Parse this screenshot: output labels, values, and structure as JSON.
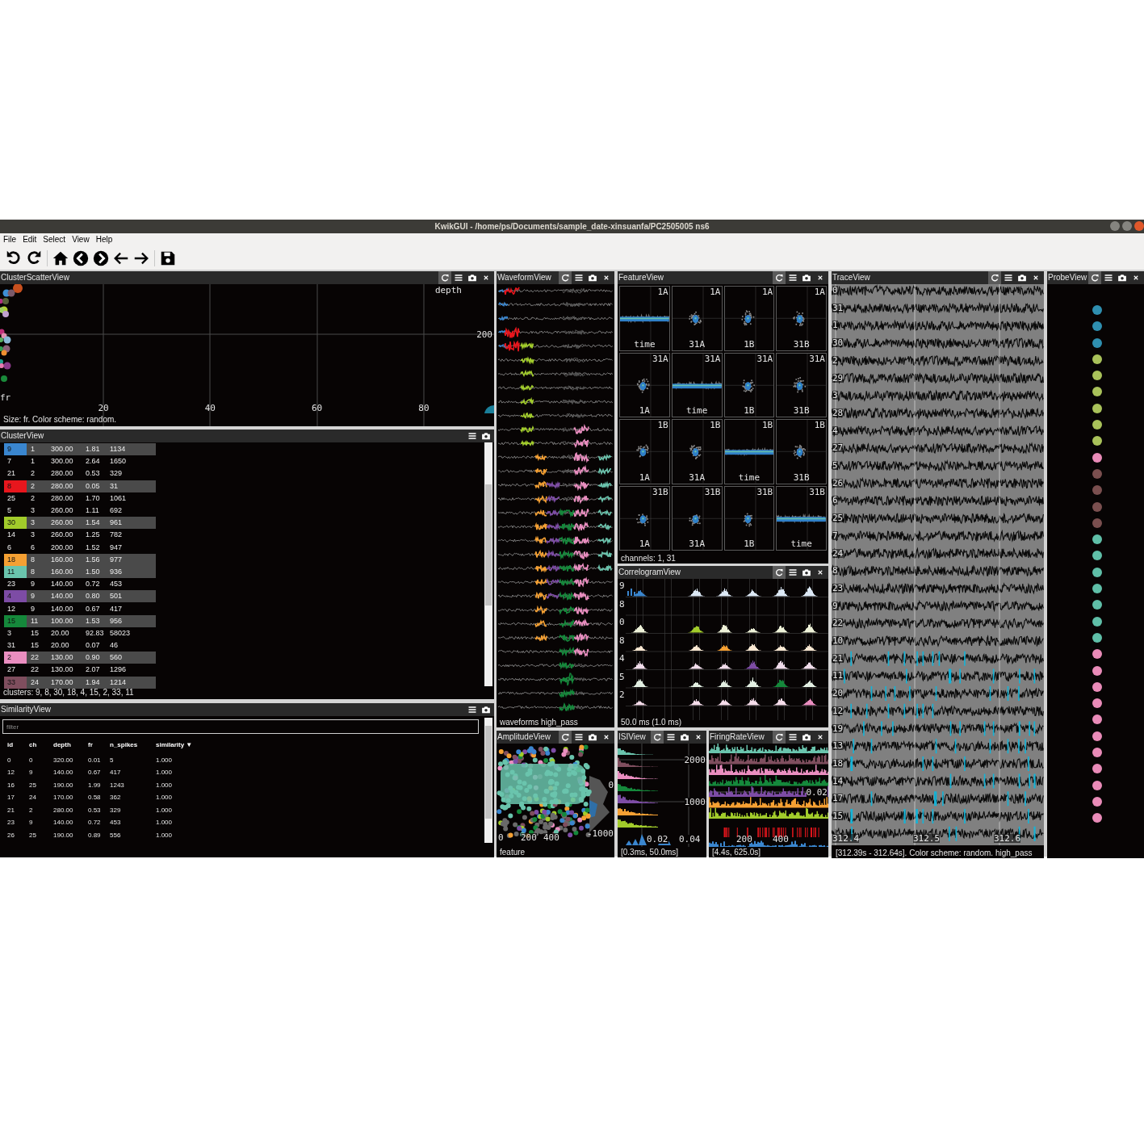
{
  "window": {
    "title": "KwikGUI - /home/ps/Documents/sample_date-xinsuanfa/PC2505005 ns6"
  },
  "menu": [
    "File",
    "Edit",
    "Select",
    "View",
    "Help"
  ],
  "cluster_scatter": {
    "title": "ClusterScatterView",
    "refresh_button": true,
    "close_button": true,
    "y_title": "depth",
    "y_ticks": [
      "200"
    ],
    "x_title": "fr",
    "x_ticks": [
      "20",
      "40",
      "60",
      "80"
    ],
    "status": "Size: fr. Color scheme: random."
  },
  "cluster_view": {
    "title": "ClusterView",
    "rows": [
      {
        "id": "9",
        "ch": "1",
        "depth": "300.00",
        "fr": "1.81",
        "n_spikes": "1134",
        "selected": true,
        "color": "#3a86cf"
      },
      {
        "id": "7",
        "ch": "1",
        "depth": "300.00",
        "fr": "2.64",
        "n_spikes": "1650",
        "selected": false
      },
      {
        "id": "21",
        "ch": "2",
        "depth": "280.00",
        "fr": "0.53",
        "n_spikes": "329",
        "selected": false
      },
      {
        "id": "8",
        "ch": "2",
        "depth": "280.00",
        "fr": "0.05",
        "n_spikes": "31",
        "selected": true,
        "color": "#e8161d"
      },
      {
        "id": "25",
        "ch": "2",
        "depth": "280.00",
        "fr": "1.70",
        "n_spikes": "1061",
        "selected": false
      },
      {
        "id": "5",
        "ch": "3",
        "depth": "260.00",
        "fr": "1.11",
        "n_spikes": "692",
        "selected": false
      },
      {
        "id": "30",
        "ch": "3",
        "depth": "260.00",
        "fr": "1.54",
        "n_spikes": "961",
        "selected": true,
        "color": "#a2cc2b"
      },
      {
        "id": "14",
        "ch": "3",
        "depth": "260.00",
        "fr": "1.25",
        "n_spikes": "782",
        "selected": false
      },
      {
        "id": "6",
        "ch": "6",
        "depth": "200.00",
        "fr": "1.52",
        "n_spikes": "947",
        "selected": false
      },
      {
        "id": "18",
        "ch": "8",
        "depth": "160.00",
        "fr": "1.56",
        "n_spikes": "977",
        "selected": true,
        "color": "#f5a033"
      },
      {
        "id": "11",
        "ch": "8",
        "depth": "160.00",
        "fr": "1.50",
        "n_spikes": "936",
        "selected": true,
        "color": "#6ac4ad"
      },
      {
        "id": "23",
        "ch": "9",
        "depth": "140.00",
        "fr": "0.72",
        "n_spikes": "453",
        "selected": false
      },
      {
        "id": "4",
        "ch": "9",
        "depth": "140.00",
        "fr": "0.80",
        "n_spikes": "501",
        "selected": true,
        "color": "#7d4ca5"
      },
      {
        "id": "12",
        "ch": "9",
        "depth": "140.00",
        "fr": "0.67",
        "n_spikes": "417",
        "selected": false
      },
      {
        "id": "15",
        "ch": "11",
        "depth": "100.00",
        "fr": "1.53",
        "n_spikes": "956",
        "selected": true,
        "color": "#15883b"
      },
      {
        "id": "3",
        "ch": "15",
        "depth": "20.00",
        "fr": "92.83",
        "n_spikes": "58023",
        "selected": false
      },
      {
        "id": "31",
        "ch": "15",
        "depth": "20.00",
        "fr": "0.07",
        "n_spikes": "46",
        "selected": false
      },
      {
        "id": "2",
        "ch": "22",
        "depth": "130.00",
        "fr": "0.90",
        "n_spikes": "560",
        "selected": true,
        "color": "#ea8ec0"
      },
      {
        "id": "27",
        "ch": "22",
        "depth": "130.00",
        "fr": "2.07",
        "n_spikes": "1296",
        "selected": false
      },
      {
        "id": "33",
        "ch": "24",
        "depth": "170.00",
        "fr": "1.94",
        "n_spikes": "1214",
        "selected": true,
        "color": "#7f4e5e"
      }
    ],
    "status": "clusters: 9, 8, 30, 18, 4, 15, 2, 33, 11"
  },
  "similarity_view": {
    "title": "SimilarityView",
    "filter": {
      "placeholder": "filter"
    },
    "columns": [
      "id",
      "ch",
      "depth",
      "fr",
      "n_spikes",
      "similarity ▼"
    ],
    "rows": [
      [
        "0",
        "0",
        "320.00",
        "0.01",
        "5",
        "1.000"
      ],
      [
        "12",
        "9",
        "140.00",
        "0.67",
        "417",
        "1.000"
      ],
      [
        "16",
        "25",
        "190.00",
        "1.99",
        "1243",
        "1.000"
      ],
      [
        "17",
        "24",
        "170.00",
        "0.58",
        "362",
        "1.000"
      ],
      [
        "21",
        "2",
        "280.00",
        "0.53",
        "329",
        "1.000"
      ],
      [
        "23",
        "9",
        "140.00",
        "0.72",
        "453",
        "1.000"
      ],
      [
        "26",
        "25",
        "190.00",
        "0.89",
        "556",
        "1.000"
      ]
    ]
  },
  "waveform_view": {
    "title": "WaveformView",
    "refresh_button": true,
    "close_button": true,
    "footer": "waveforms high_pass"
  },
  "amplitude_view": {
    "title": "AmplitudeView",
    "refresh_button": true,
    "close_button": true,
    "x_ticks": [
      "0",
      "200",
      "400"
    ],
    "y_ticks": [
      "0",
      "-1000"
    ],
    "footer": "feature"
  },
  "feature_view": {
    "title": "FeatureView",
    "refresh_button": true,
    "close_button": true,
    "grid": [
      [
        {
          "y_label": "1A",
          "x_label": "time",
          "kind": "time"
        },
        {
          "y_label": "1A",
          "x_label": "31A",
          "kind": "scatter"
        },
        {
          "y_label": "1A",
          "x_label": "1B",
          "kind": "scatter"
        },
        {
          "y_label": "1A",
          "x_label": "31B",
          "kind": "scatter"
        }
      ],
      [
        {
          "y_label": "31A",
          "x_label": "1A",
          "kind": "scatter"
        },
        {
          "y_label": "31A",
          "x_label": "time",
          "kind": "time"
        },
        {
          "y_label": "31A",
          "x_label": "1B",
          "kind": "scatter"
        },
        {
          "y_label": "31A",
          "x_label": "31B",
          "kind": "scatter"
        }
      ],
      [
        {
          "y_label": "1B",
          "x_label": "1A",
          "kind": "scatter"
        },
        {
          "y_label": "1B",
          "x_label": "31A",
          "kind": "scatter"
        },
        {
          "y_label": "1B",
          "x_label": "time",
          "kind": "time"
        },
        {
          "y_label": "1B",
          "x_label": "31B",
          "kind": "scatter"
        }
      ],
      [
        {
          "y_label": "31B",
          "x_label": "1A",
          "kind": "scatter"
        },
        {
          "y_label": "31B",
          "x_label": "31A",
          "kind": "scatter"
        },
        {
          "y_label": "31B",
          "x_label": "1B",
          "kind": "scatter"
        },
        {
          "y_label": "31B",
          "x_label": "time",
          "kind": "time"
        }
      ]
    ],
    "footer": "channels: 1, 31"
  },
  "correlogram_view": {
    "title": "CorrelogramView",
    "refresh_button": true,
    "close_button": true,
    "row_labels": [
      "9",
      "8",
      "0",
      "8",
      "4",
      "5",
      "2"
    ],
    "footer": "50.0 ms (1.0 ms)"
  },
  "isi_view": {
    "title": "ISIView",
    "refresh_button": true,
    "close_button": true,
    "y_ticks": [
      "2000",
      "1000"
    ],
    "x_ticks": [
      "0.02",
      "0.04"
    ],
    "footer": "[0.3ms, 50.0ms]"
  },
  "firing_rate_view": {
    "title": "FiringRateView",
    "refresh_button": true,
    "close_button": true,
    "y_ticks": [
      "0.02"
    ],
    "x_ticks": [
      "200",
      "400"
    ],
    "footer": "[4.4s, 625.0s]"
  },
  "trace_view": {
    "title": "TraceView",
    "refresh_button": true,
    "close_button": true,
    "channel_labels": [
      "0",
      "31",
      "1",
      "30",
      "2",
      "29",
      "3",
      "28",
      "4",
      "27",
      "5",
      "26",
      "6",
      "25",
      "7",
      "24",
      "8",
      "23",
      "9",
      "22",
      "10",
      "21",
      "11",
      "20",
      "12",
      "19",
      "13",
      "18",
      "14",
      "17",
      "15"
    ],
    "x_ticks": [
      "312.4",
      "312.5",
      "312.6"
    ],
    "footer": "[312.39s - 312.64s]. Color scheme: random. high_pass"
  },
  "probe_view": {
    "title": "ProbeView",
    "refresh_button": true,
    "close_button": true,
    "sites": [
      {
        "color": "#2f8fb0"
      },
      {
        "color": "#2f8fb0"
      },
      {
        "color": "#2f8fb0"
      },
      {
        "color": "#a9c25a"
      },
      {
        "color": "#a9c25a"
      },
      {
        "color": "#a9c25a"
      },
      {
        "color": "#a9c25a"
      },
      {
        "color": "#a9c25a"
      },
      {
        "color": "#a9c25a"
      },
      {
        "color": "#e98bb8"
      },
      {
        "color": "#7a4f4f"
      },
      {
        "color": "#7a4f4f"
      },
      {
        "color": "#7a4f4f"
      },
      {
        "color": "#7a4f4f"
      },
      {
        "color": "#5fbfa8"
      },
      {
        "color": "#5fbfa8"
      },
      {
        "color": "#5fbfa8"
      },
      {
        "color": "#5fbfa8"
      },
      {
        "color": "#5fbfa8"
      },
      {
        "color": "#5fbfa8"
      },
      {
        "color": "#5fbfa8"
      },
      {
        "color": "#e98bb8"
      },
      {
        "color": "#e98bb8"
      },
      {
        "color": "#e98bb8"
      },
      {
        "color": "#e98bb8"
      },
      {
        "color": "#e98bb8"
      },
      {
        "color": "#e98bb8"
      },
      {
        "color": "#e98bb8"
      },
      {
        "color": "#e98bb8"
      },
      {
        "color": "#e98bb8"
      },
      {
        "color": "#e98bb8"
      },
      {
        "color": "#e98bb8"
      }
    ]
  }
}
